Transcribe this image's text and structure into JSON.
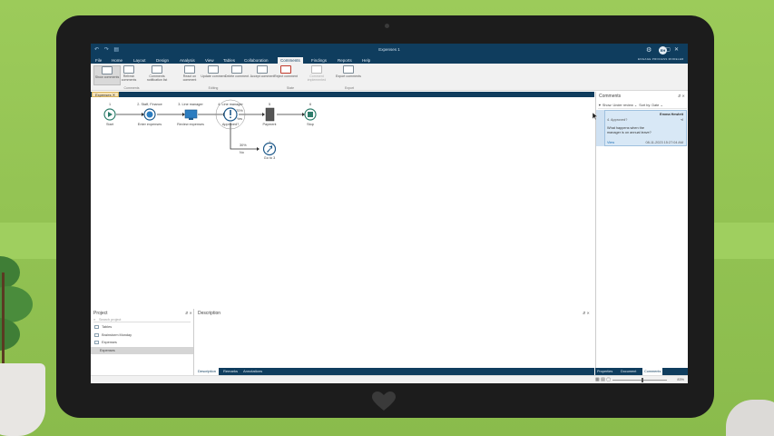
{
  "app": {
    "title": "Expenses 1",
    "user_initials": "EH",
    "brand": "ENGAGE PROCESS MODELER"
  },
  "menu_tabs": [
    "File",
    "Home",
    "Layout",
    "Design",
    "Analysis",
    "View",
    "Tables",
    "Collaboration",
    "Comments",
    "Findings",
    "Reports",
    "Help"
  ],
  "active_menu_tab": "Comments",
  "ribbon": {
    "buttons": [
      {
        "label": "Show comments",
        "selected": true,
        "disabled": false
      },
      {
        "label": "Refresh comments",
        "selected": false,
        "disabled": false
      },
      {
        "label": "Comments notification list",
        "selected": false,
        "disabled": false
      },
      {
        "label": "React on comment",
        "selected": false,
        "disabled": false
      },
      {
        "label": "Update comment",
        "selected": false,
        "disabled": false
      },
      {
        "label": "Delete comment",
        "selected": false,
        "disabled": false
      },
      {
        "label": "Accept comment",
        "selected": false,
        "disabled": false
      },
      {
        "label": "Reject comment",
        "selected": false,
        "disabled": false
      },
      {
        "label": "Comment implemented",
        "selected": false,
        "disabled": true
      },
      {
        "label": "Export comments",
        "selected": false,
        "disabled": false
      }
    ],
    "groups": [
      "Comments",
      "Editing",
      "State",
      "Export"
    ]
  },
  "document_tab": "Expenses",
  "flow": {
    "nodes": [
      {
        "num": "1",
        "role": "",
        "label": "Start",
        "kind": "start"
      },
      {
        "num": "2",
        "role": "Staff, Finance",
        "label": "Enter expenses",
        "kind": "task"
      },
      {
        "num": "3",
        "role": "Line manager",
        "label": "Review expenses",
        "kind": "screen"
      },
      {
        "num": "4",
        "role": "Line manager",
        "label": "Approved?",
        "kind": "decision"
      },
      {
        "num": "5",
        "role": "",
        "label": "Payment",
        "kind": "doc"
      },
      {
        "num": "6",
        "role": "",
        "label": "Stop",
        "kind": "stop"
      },
      {
        "num": "7",
        "role": "",
        "label": "Go to 3",
        "kind": "goto"
      }
    ],
    "edge_labels": {
      "yes_pct": "70%",
      "yes": "Yes",
      "no_pct": "30%",
      "no": "No"
    }
  },
  "project": {
    "title": "Project",
    "search_placeholder": "Search project",
    "items": [
      "Tables",
      "Brainstorm Monday",
      "Expenses",
      "Expenses"
    ]
  },
  "description": {
    "title": "Description",
    "tabs": [
      "Description",
      "Remarks",
      "Annotations"
    ]
  },
  "comments": {
    "title": "Comments",
    "show_label": "Show:",
    "show_value": "Under review",
    "sort_label": "Sort by:",
    "sort_value": "Date",
    "card": {
      "author": "Emma Hewlett",
      "ref": "4. Approved?",
      "text": "What happens when the manager is on annual leave?",
      "link": "View",
      "timestamp": "08-11-2023 15:27:04 AM"
    },
    "bottom_tabs": [
      "Properties",
      "Document",
      "Comments"
    ]
  },
  "status": {
    "zoom": "83%"
  },
  "colors": {
    "navy": "#0f3d5e",
    "teal": "#2e7d6b",
    "accent": "#1f6fb5"
  }
}
